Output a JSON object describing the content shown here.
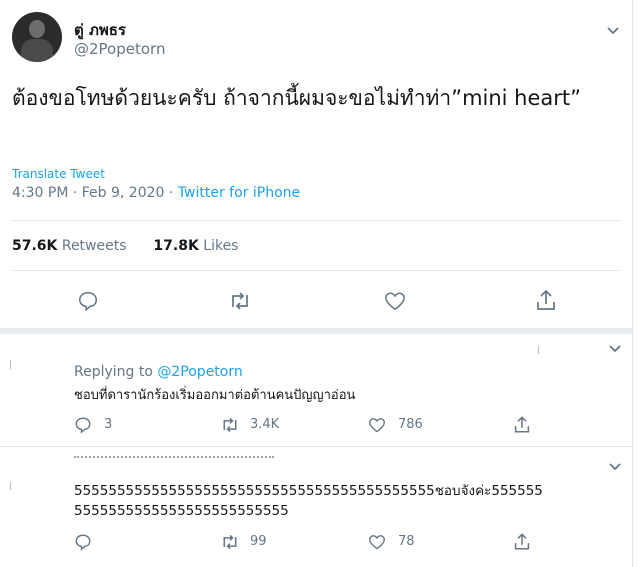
{
  "tweet": {
    "author_name": "ตู่ ภพธร",
    "author_handle": "@2Popetorn",
    "text": "ต้องขอโทษด้วยนะครับ ถ้าจากนี้ผมจะขอไม่ทำท่า”mini heart”",
    "translate_label": "Translate Tweet",
    "time": "4:30 PM · Feb 9, 2020",
    "separator": " · ",
    "source": "Twitter for iPhone",
    "retweets_count": "57.6K",
    "retweets_label": "Retweets",
    "likes_count": "17.8K",
    "likes_label": "Likes"
  },
  "replies": [
    {
      "replying_prefix": "Replying to",
      "replying_handle": "@2Popetorn",
      "text": "ชอบที่ดารานักร้องเริ่มออกมาต่อต้านคนปัญญาอ่อน",
      "reply_count": "3",
      "retweet_count": "3.4K",
      "like_count": "786"
    },
    {
      "text": "555555555555555555555555555555555555555555ชอบจังค่ะ5555555555555555555555555555555",
      "reply_count": "",
      "retweet_count": "99",
      "like_count": "78"
    }
  ],
  "icons": [
    "chevron-down-icon",
    "reply-icon",
    "retweet-icon",
    "like-icon",
    "share-icon"
  ],
  "colors": {
    "accent": "#1da1f2",
    "muted": "#657786",
    "border": "#e1e8ed",
    "text": "#14171a"
  }
}
